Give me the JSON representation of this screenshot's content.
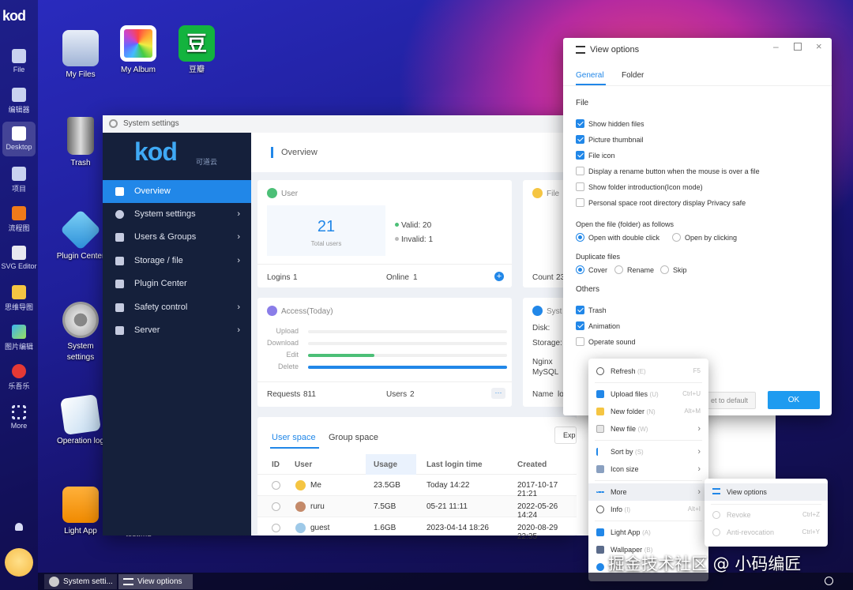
{
  "dock": {
    "logo": "kod",
    "items": [
      {
        "label": "File"
      },
      {
        "label": "编辑器"
      },
      {
        "label": "Desktop"
      },
      {
        "label": "项目"
      },
      {
        "label": "流程图"
      },
      {
        "label": "SVG Editor"
      },
      {
        "label": "思维导图"
      },
      {
        "label": "图片编辑"
      },
      {
        "label": "乐吾乐"
      },
      {
        "label": "More"
      }
    ]
  },
  "desktop": {
    "icons": [
      {
        "label": "My Files"
      },
      {
        "label": "My Album"
      },
      {
        "label": "豆瓣"
      },
      {
        "label": "Trash"
      },
      {
        "label": "Plugin Center"
      },
      {
        "label": "System settings"
      },
      {
        "label": "Operation log"
      },
      {
        "label": "Light App"
      }
    ],
    "douban_glyph": "豆",
    "truncated_label": "test.md"
  },
  "system_settings": {
    "title": "System settings",
    "brand": "kod",
    "brand_sub": "可道云",
    "header": "Overview",
    "menu": [
      {
        "label": "Overview"
      },
      {
        "label": "System settings"
      },
      {
        "label": "Users & Groups"
      },
      {
        "label": "Storage / file"
      },
      {
        "label": "Plugin Center"
      },
      {
        "label": "Safety control"
      },
      {
        "label": "Server"
      }
    ],
    "user_card": {
      "title": "User",
      "total": "21",
      "total_label": "Total users",
      "valid": "Valid: 20",
      "invalid": "Invalid: 1",
      "logins_label": "Logins",
      "logins": "1",
      "online_label": "Online",
      "online": "1"
    },
    "file_card": {
      "title": "File",
      "count_label": "Count",
      "count": "23"
    },
    "access_card": {
      "title": "Access(Today)",
      "rows": [
        "Upload",
        "Download",
        "Edit",
        "Delete"
      ],
      "requests_label": "Requests",
      "requests": "811",
      "users_label": "Users",
      "users": "2",
      "more": "···"
    },
    "sys_card": {
      "title": "Syst",
      "disk": "Disk:",
      "storage": "Storage:",
      "nginx": "Nginx",
      "mysql": "MySQL",
      "name_label": "Name",
      "name": "lo"
    },
    "tabs": [
      "User space",
      "Group space"
    ],
    "export": "Exp",
    "table": {
      "columns": [
        "ID",
        "User",
        "Usage",
        "Last login time",
        "Created"
      ],
      "rows": [
        {
          "user": "Me",
          "usage": "23.5GB",
          "login": "Today 14:22",
          "created": "2017-10-17 21:21"
        },
        {
          "user": "ruru",
          "usage": "7.5GB",
          "login": "05-21 11:11",
          "created": "2022-05-26 14:24"
        },
        {
          "user": "guest",
          "usage": "1.6GB",
          "login": "2023-04-14 18:26",
          "created": "2020-08-29 22:35"
        }
      ]
    }
  },
  "view_options": {
    "title": "View options",
    "tabs": [
      "General",
      "Folder"
    ],
    "file_section": "File",
    "file_opts": [
      {
        "label": "Show hidden files",
        "on": true
      },
      {
        "label": "Picture thumbnail",
        "on": true
      },
      {
        "label": "File icon",
        "on": true
      },
      {
        "label": "Display a rename button when the mouse is over a file",
        "on": false
      },
      {
        "label": "Show folder introduction(Icon mode)",
        "on": false
      },
      {
        "label": "Personal space root directory display Privacy safe",
        "on": false
      }
    ],
    "open_section": "Open the file (folder) as follows",
    "open_opts": [
      "Open with double click",
      "Open by clicking"
    ],
    "dup_section": "Duplicate files",
    "dup_opts": [
      "Cover",
      "Rename",
      "Skip"
    ],
    "others_section": "Others",
    "others_opts": [
      {
        "label": "Trash",
        "on": true
      },
      {
        "label": "Animation",
        "on": true
      },
      {
        "label": "Operate sound",
        "on": false
      }
    ],
    "reset": "et to default",
    "ok": "OK"
  },
  "context_menu": {
    "items": [
      {
        "label": "Refresh",
        "key": "(E)",
        "sc": "F5"
      },
      {
        "label": "Upload files",
        "key": "(U)",
        "sc": "Ctrl+U"
      },
      {
        "label": "New folder",
        "key": "(N)",
        "sc": "Alt+M"
      },
      {
        "label": "New file",
        "key": "(W)",
        "sc": "›"
      },
      {
        "label": "Sort by",
        "key": "(S)",
        "sc": "›"
      },
      {
        "label": "Icon size",
        "key": "",
        "sc": "›"
      },
      {
        "label": "More",
        "key": "",
        "sc": "›"
      },
      {
        "label": "Info",
        "key": "(I)",
        "sc": "Alt+I"
      },
      {
        "label": "Light App",
        "key": "(A)",
        "sc": ""
      },
      {
        "label": "Wallpaper",
        "key": "(B)",
        "sc": ""
      }
    ]
  },
  "submenu": {
    "items": [
      {
        "label": "View options"
      },
      {
        "label": "Revoke",
        "sc": "Ctrl+Z"
      },
      {
        "label": "Anti-revocation",
        "sc": "Ctrl+Y"
      }
    ]
  },
  "taskbar": {
    "items": [
      "System setti...",
      "View options"
    ]
  },
  "watermark": "掘金技术社区 @ 小码编匠"
}
